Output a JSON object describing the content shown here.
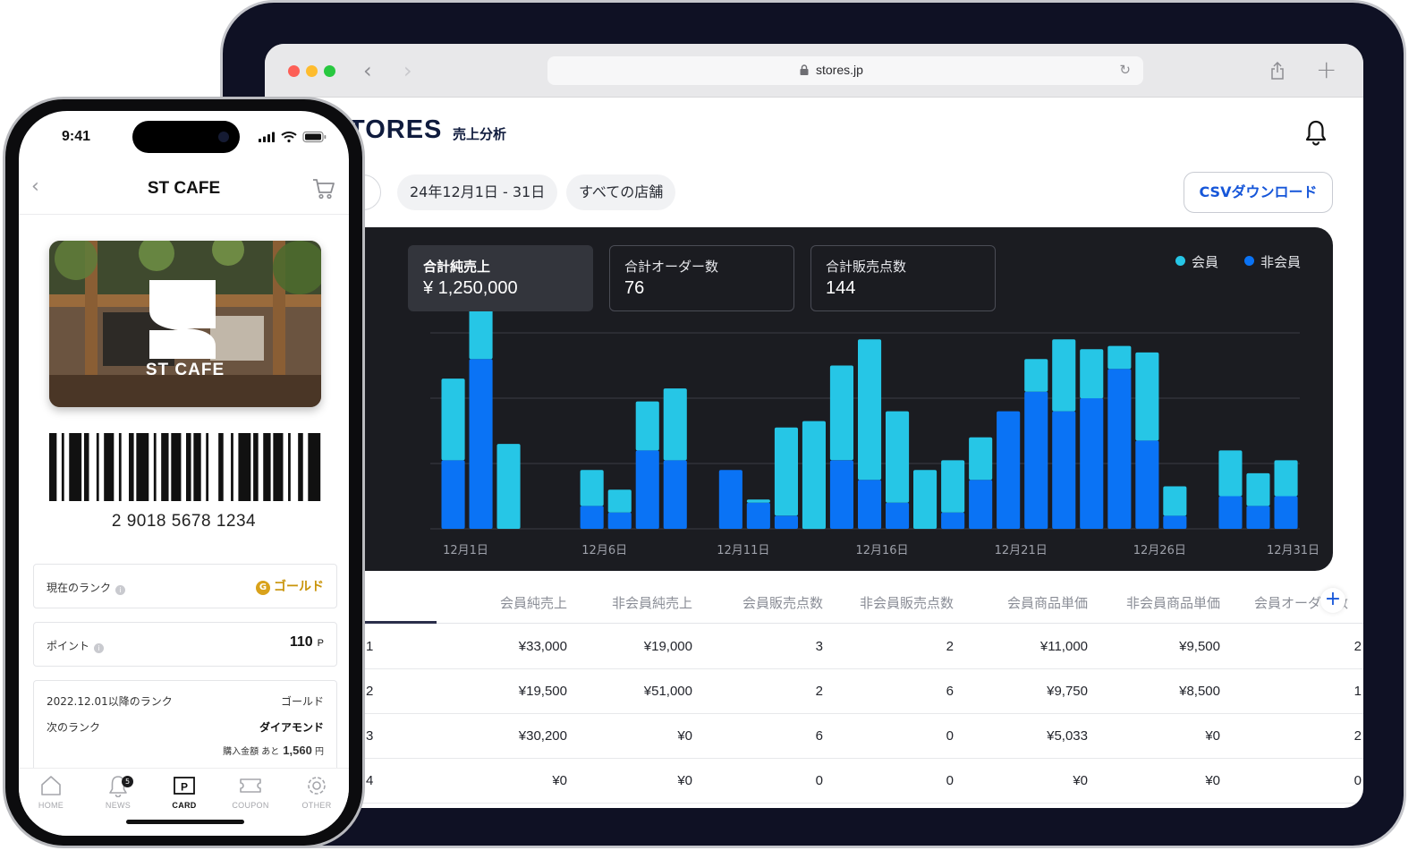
{
  "browser": {
    "url": "stores.jp"
  },
  "app": {
    "logo": "TORES",
    "section": "売上分析"
  },
  "filters": {
    "date_range": "24年12月1日 - 31日",
    "store": "すべての店舗",
    "csv_label": "CSVダウンロード"
  },
  "stats": [
    {
      "label": "合計純売上",
      "value": "¥ 1,250,000"
    },
    {
      "label": "合計オーダー数",
      "value": "76"
    },
    {
      "label": "合計販売点数",
      "value": "144"
    }
  ],
  "legend": {
    "member": "会員",
    "non_member": "非会員"
  },
  "colors": {
    "member": "#26c6e6",
    "non_member": "#0a73f5",
    "accent": "#1656d9",
    "gold": "#c9940a"
  },
  "chart_data": {
    "type": "bar",
    "stacked": true,
    "x_tick_labels": [
      "12月1日",
      "12月6日",
      "12月11日",
      "12月16日",
      "12月21日",
      "12月26日",
      "12月31日"
    ],
    "days": [
      1,
      2,
      3,
      4,
      5,
      6,
      7,
      8,
      9,
      10,
      11,
      12,
      13,
      14,
      15,
      16,
      17,
      18,
      19,
      20,
      21,
      22,
      23,
      24,
      25,
      26,
      27,
      28,
      29,
      30,
      31
    ],
    "series": [
      {
        "name": "非会員",
        "values": [
          21,
          52,
          0,
          0,
          0,
          7,
          5,
          24,
          21,
          0,
          18,
          8,
          4,
          0,
          21,
          15,
          8,
          0,
          5,
          15,
          36,
          42,
          36,
          40,
          49,
          27,
          4,
          0,
          10,
          7,
          10
        ]
      },
      {
        "name": "会員",
        "values": [
          25,
          16,
          26,
          0,
          0,
          11,
          7,
          15,
          22,
          0,
          0,
          1,
          27,
          33,
          29,
          43,
          28,
          18,
          16,
          13,
          0,
          10,
          22,
          15,
          7,
          27,
          9,
          0,
          14,
          10,
          11
        ]
      }
    ],
    "ylim": [
      0,
      60
    ],
    "grid": true
  },
  "table": {
    "headers": [
      "会員純売上",
      "非会員純売上",
      "会員販売点数",
      "非会員販売点数",
      "会員商品単価",
      "非会員商品単価",
      "会員オーダー数"
    ],
    "rows": [
      {
        "id": "1",
        "cells": [
          "¥33,000",
          "¥19,000",
          "3",
          "2",
          "¥11,000",
          "¥9,500",
          "2"
        ]
      },
      {
        "id": "2",
        "cells": [
          "¥19,500",
          "¥51,000",
          "2",
          "6",
          "¥9,750",
          "¥8,500",
          "1"
        ]
      },
      {
        "id": "3",
        "cells": [
          "¥30,200",
          "¥0",
          "6",
          "0",
          "¥5,033",
          "¥0",
          "2"
        ]
      },
      {
        "id": "4",
        "cells": [
          "¥0",
          "¥0",
          "0",
          "0",
          "¥0",
          "¥0",
          "0"
        ]
      }
    ]
  },
  "phone": {
    "time": "9:41",
    "title": "ST CAFE",
    "card_brand": "ST CAFE",
    "barcode_number": "2 9018 5678 1234",
    "rank_label": "現在のランク",
    "rank_info_icon": "i",
    "rank_value": "ゴールド",
    "rank_icon_letter": "G",
    "point_label": "ポイント",
    "point_info_icon": "i",
    "point_value": "110",
    "point_unit": "P",
    "next_rank_date_label": "2022.12.01以降のランク",
    "next_rank_date_value": "ゴールド",
    "next_rank_label": "次のランク",
    "next_rank_value": "ダイアモンド",
    "remaining_label": "購入金額 あと",
    "remaining_value": "1,560",
    "remaining_unit": "円",
    "tabs": [
      {
        "label": "HOME",
        "icon": "home-icon"
      },
      {
        "label": "NEWS",
        "icon": "bell-icon",
        "badge": "5"
      },
      {
        "label": "CARD",
        "icon": "card-p-icon",
        "glyph": "P",
        "active": true
      },
      {
        "label": "COUPON",
        "icon": "ticket-icon"
      },
      {
        "label": "OTHER",
        "icon": "gear-icon"
      }
    ]
  }
}
